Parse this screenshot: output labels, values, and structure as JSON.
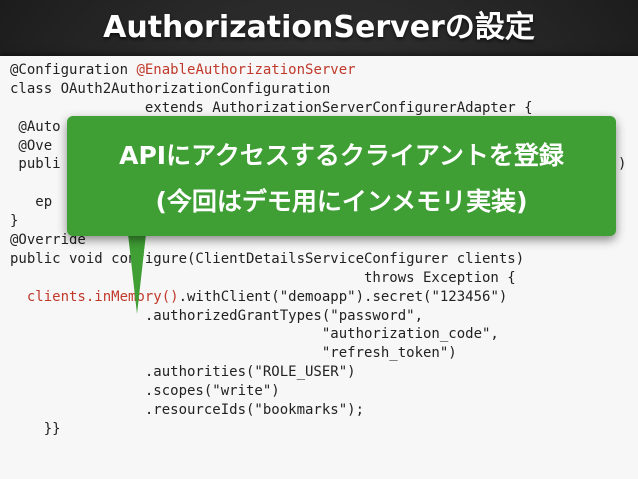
{
  "slide": {
    "title": "AuthorizationServerの設定"
  },
  "code": {
    "lines": [
      {
        "text": "@Configuration ",
        "annotation": "@EnableAuthorizationServer"
      },
      {
        "text": "class OAuth2AuthorizationConfiguration"
      },
      {
        "text": "                extends AuthorizationServerConfigurerAdapter {"
      },
      {
        "text": " @Auto"
      },
      {
        "text": " @Ove"
      },
      {
        "text": " publi",
        "tail": ")"
      },
      {
        "text": ""
      },
      {
        "text": "   ep"
      },
      {
        "text": "}"
      },
      {
        "text": "@Override"
      },
      {
        "text": "public void configure(ClientDetailsServiceConfigurer clients)"
      },
      {
        "text": "                                          throws Exception {"
      },
      {
        "prefix": "  ",
        "highlight": "clients.inMemory()",
        "text": ".withClient(\"demoapp\").secret(\"123456\")"
      },
      {
        "text": "                .authorizedGrantTypes(\"password\","
      },
      {
        "text": "                                     \"authorization_code\","
      },
      {
        "text": "                                     \"refresh_token\")"
      },
      {
        "text": "                .authorities(\"ROLE_USER\")"
      },
      {
        "text": "                .scopes(\"write\")"
      },
      {
        "text": "                .resourceIds(\"bookmarks\");"
      },
      {
        "text": "    }}"
      }
    ]
  },
  "callout": {
    "line1": "APIにアクセスするクライアントを登録",
    "line2": "(今回はデモ用にインメモリ実装)",
    "color": "#3f9f35"
  },
  "colors": {
    "annotation": "#c0392b",
    "background": "#222222",
    "panel": "#f7f7f7"
  }
}
